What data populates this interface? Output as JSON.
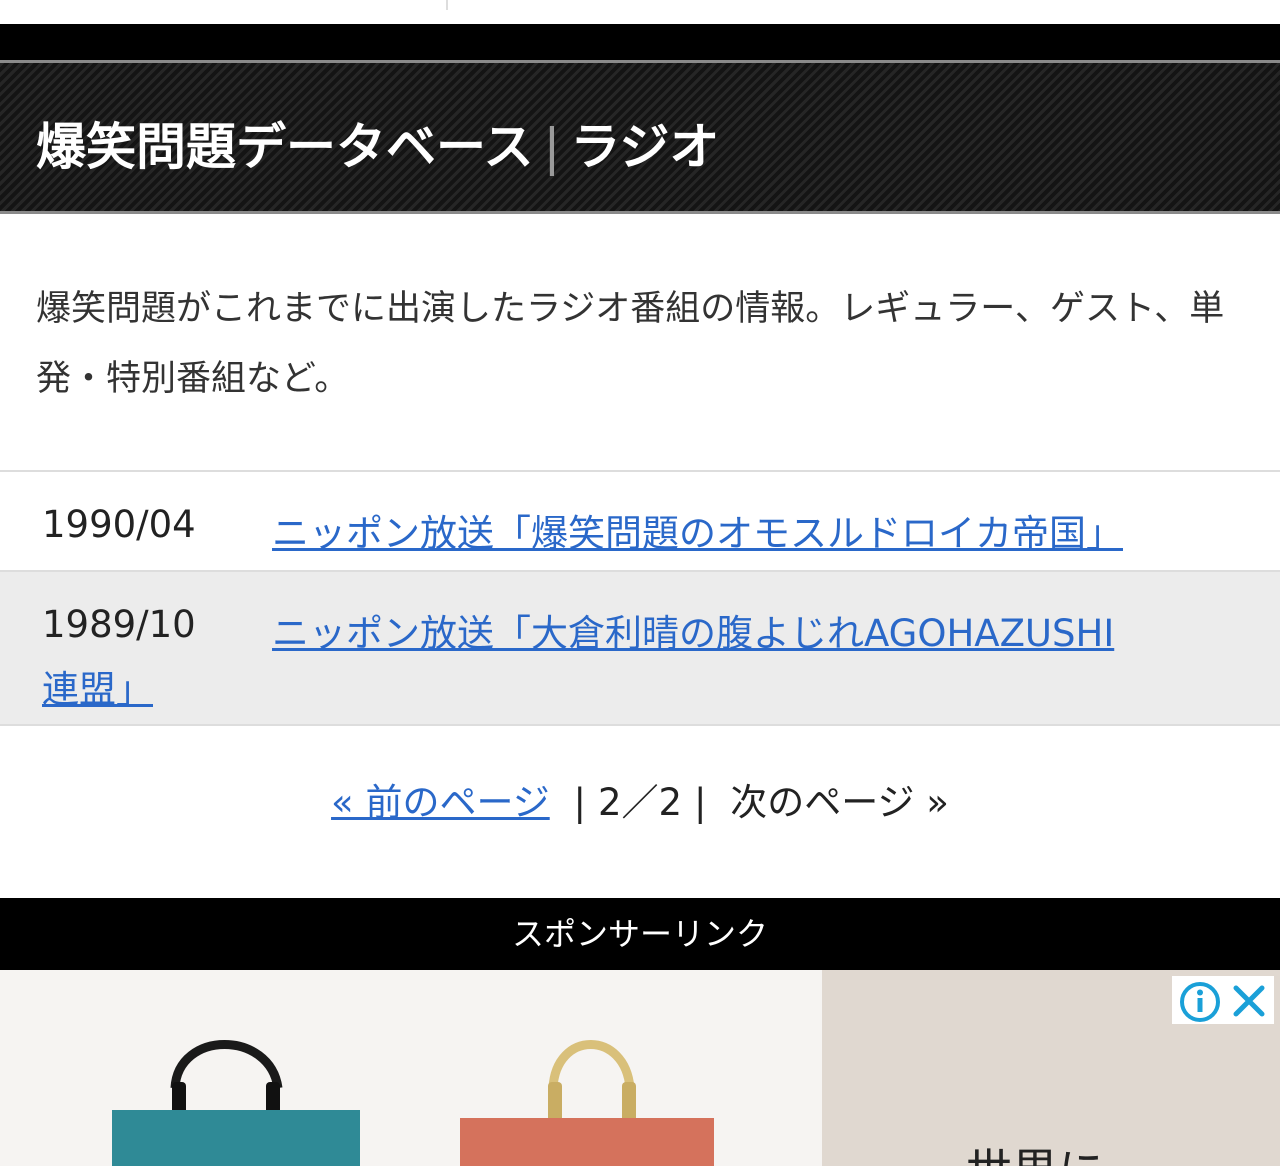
{
  "header": {
    "title": "爆笑問題データベース",
    "separator": "|",
    "section": "ラジオ"
  },
  "description": "爆笑問題がこれまでに出演したラジオ番組の情報。レギュラー、ゲスト、単発・特別番組など。",
  "entries": [
    {
      "date": "1990/04",
      "link": "ニッポン放送「爆笑問題のオモスルドロイカ帝国」",
      "link_cont": ""
    },
    {
      "date": "1989/10",
      "link": "ニッポン放送「大倉利晴の腹よじれAGOHAZUSHI",
      "link_cont": "連盟」"
    }
  ],
  "pagination": {
    "prev": "« 前のページ",
    "divider": "|",
    "current": "2／2",
    "next": "次のページ »"
  },
  "sponsor": {
    "label": "スポンサーリンク",
    "ad_text": "世界に",
    "info_icon": "info-icon",
    "close_icon": "close-icon"
  },
  "colors": {
    "link": "#2a68c9",
    "bag_teal": "#2f8a96",
    "bag_coral": "#d5725c"
  }
}
